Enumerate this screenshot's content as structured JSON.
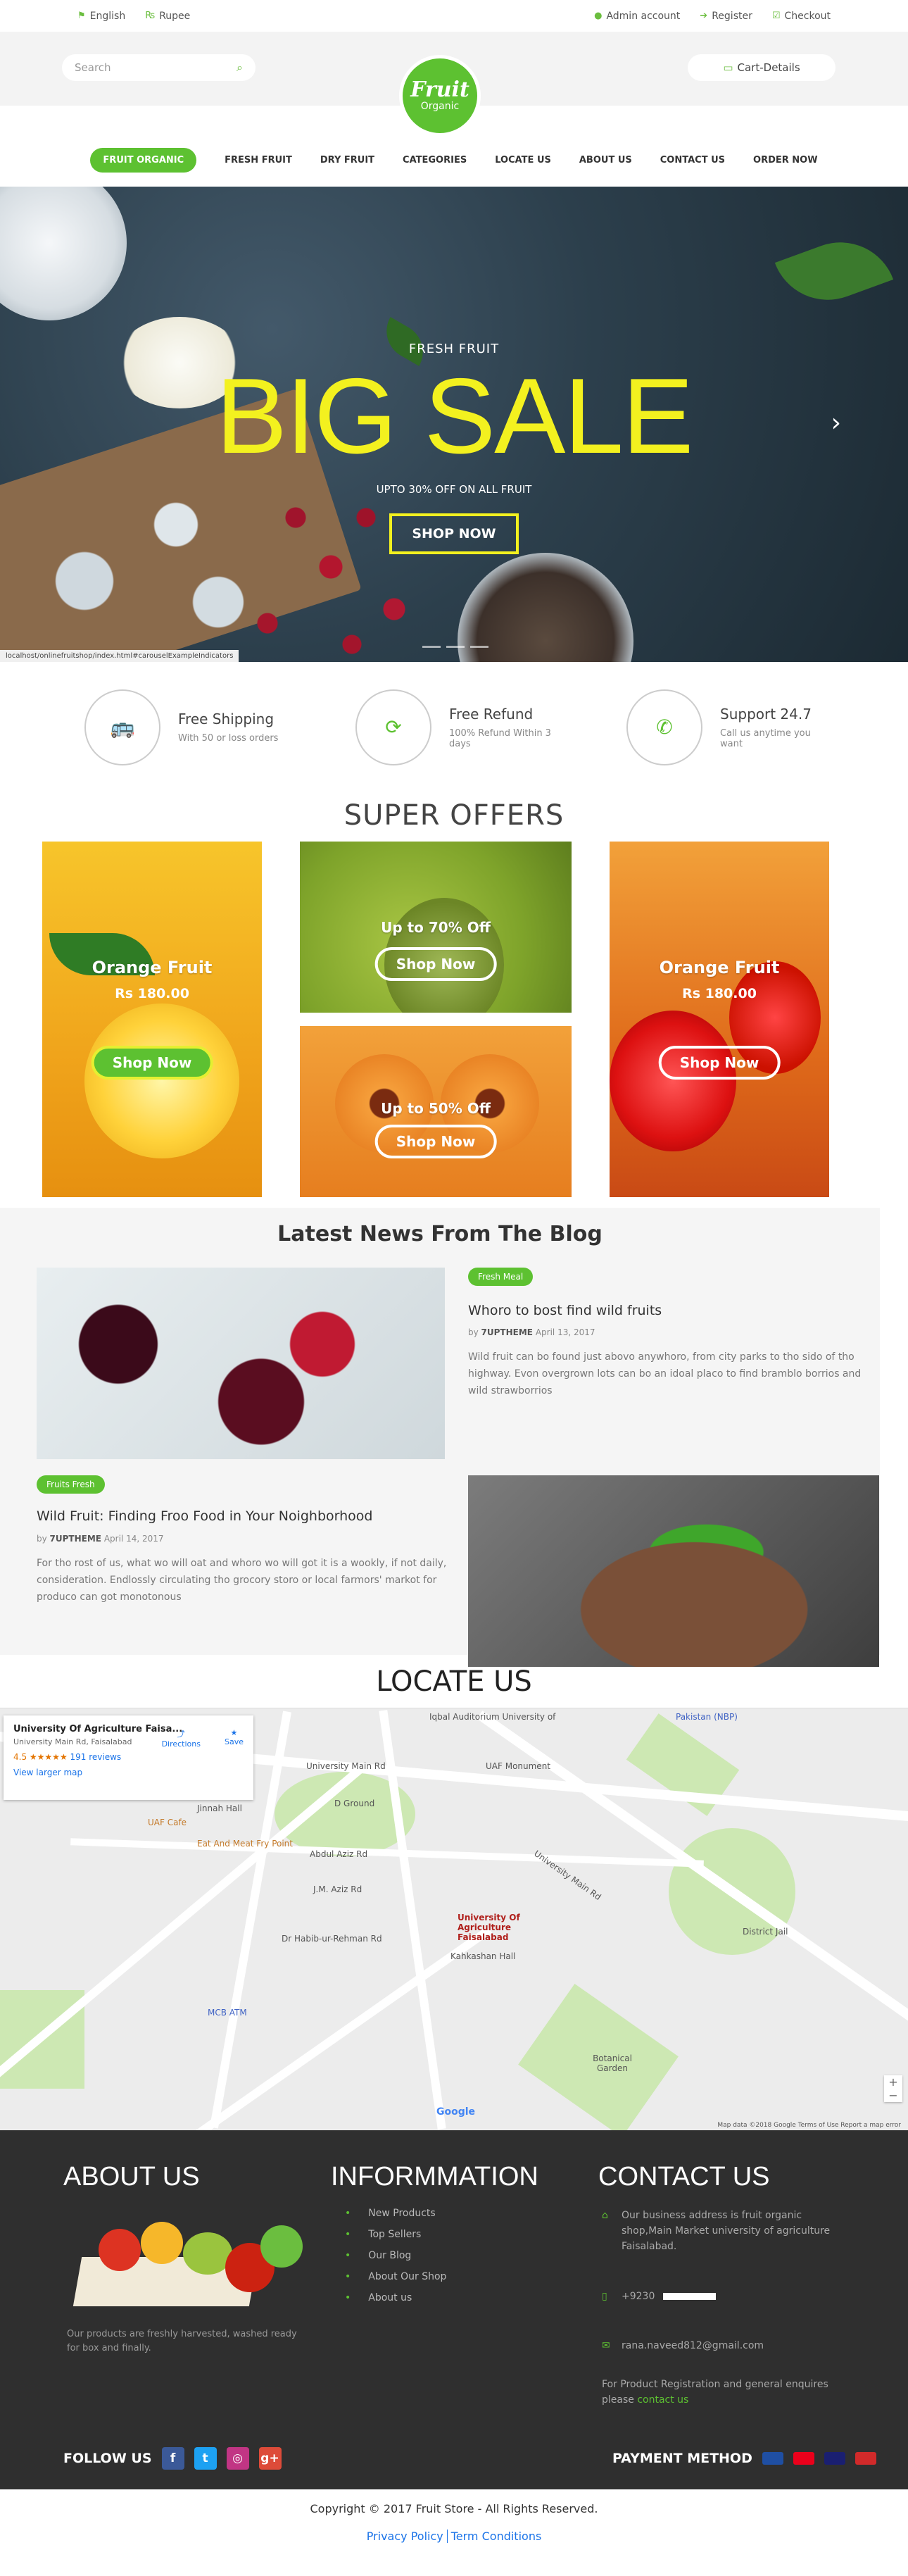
{
  "topbar": {
    "left": [
      {
        "icon": "flag-icon",
        "label": "English"
      },
      {
        "icon": "currency-icon",
        "label": "Rupee"
      }
    ],
    "right": [
      {
        "icon": "user-icon",
        "label": "Admin account"
      },
      {
        "icon": "login-icon",
        "label": "Register"
      },
      {
        "icon": "checkout-icon",
        "label": "Checkout"
      }
    ]
  },
  "header": {
    "search_placeholder": "Search",
    "logo_top": "Fruit",
    "logo_bottom": "Organic",
    "cart_label": "Cart-Details"
  },
  "nav": {
    "active": "FRUIT ORGANIC",
    "items": [
      "FRESH FRUIT",
      "DRY FRUIT",
      "CATEGORIES",
      "LOCATE US",
      "ABOUT US",
      "CONTACT US",
      "ORDER NOW"
    ]
  },
  "hero": {
    "subtitle": "FRESH FRUIT",
    "headline": "BIG SALE",
    "offer": "UPTO 30% OFF ON ALL FRUIT",
    "button": "SHOP NOW",
    "status_url": "localhost/onlinefruitshop/index.html#carouselExampleIndicators"
  },
  "features": [
    {
      "title": "Free Shipping",
      "desc": "With 50 or loss orders"
    },
    {
      "title": "Free Refund",
      "desc": "100% Refund Within 3 days"
    },
    {
      "title": "Support 24.7",
      "desc": "Call us anytime you want"
    }
  ],
  "offers": {
    "title": "SUPER OFFERS",
    "card1": {
      "name": "Orange Fruit",
      "price": "Rs 180.00",
      "button": "Shop Now"
    },
    "card2": {
      "text": "Up to 70% Off",
      "button": "Shop Now"
    },
    "card3": {
      "text": "Up to 50% Off",
      "button": "Shop Now"
    },
    "card4": {
      "name": "Orange Fruit",
      "price": "Rs 180.00",
      "button": "Shop Now"
    }
  },
  "blog": {
    "title": "Latest News From The Blog",
    "post1": {
      "tag": "Fresh Meal",
      "title": "Whoro to bost find wild fruits",
      "author": "7UPTHEME",
      "date": "April 13, 2017",
      "desc": "Wild fruit can bo found just abovo anywhoro, from city parks to tho sido of tho highway. Evon overgrown lots can bo an idoal placo to find bramblo borrios and wild strawborrios"
    },
    "post2": {
      "tag": "Fruits Fresh",
      "title": "Wild Fruit: Finding Froo Food in Your Noighborhood",
      "author": "7UPTHEME",
      "date": "April 14, 2017",
      "desc": "For tho rost of us, what wo will oat and whoro wo will got it is a wookly, if not daily, consideration. Endlossly circulating tho grocory storo or local farmors' markot for produco can got monotonous"
    }
  },
  "locate": {
    "title": "LOCATE US",
    "card_title": "University Of Agriculture Faisa...",
    "card_addr": "University Main Rd, Faisalabad",
    "rating": "4.5",
    "reviews": "191 reviews",
    "larger_map": "View larger map",
    "directions": "Directions",
    "save": "Save",
    "labels": [
      "Iqbal Auditorium University of",
      "Pakistan (NBP)",
      "University Main Rd",
      "UAF Monument",
      "Jinnah Hall",
      "UAF Cafe",
      "Eat And Meat Fry Point",
      "D Ground",
      "Abdul Aziz Rd",
      "J.M. Aziz Rd",
      "Dr Habib-ur-Rehman Rd",
      "University Of Agriculture Faisalabad",
      "Kahkashan Hall",
      "District Jail",
      "MCB ATM",
      "Botanical Garden",
      "University Main Rd"
    ],
    "footer": "Map data ©2018 Google   Terms of Use   Report a map error",
    "google": "Google"
  },
  "footer": {
    "about_title": "ABOUT US",
    "about_text": "Our products are freshly harvested, washed ready for box and finally.",
    "info_title": "INFORMMATION",
    "info_links": [
      "New Products",
      "Top Sellers",
      "Our Blog",
      "About Our Shop",
      "About us"
    ],
    "contact_title": "CONTACT US",
    "address": "Our business address is fruit organic shop,Main Market university of agriculture Faisalabad.",
    "phone": "+9230",
    "email": "rana.naveed812@gmail.com",
    "enquiry": "For Product Registration and general enquires please",
    "contact_link": "contact us",
    "follow": "FOLLOW US",
    "payment": "PAYMENT METHOD"
  },
  "copyright": {
    "text": "Copyright © 2017 Fruit Store - All Rights Reserved.",
    "privacy": "Privacy Policy",
    "terms": "Term Conditions"
  },
  "colors": {
    "accent": "#5dc131",
    "hero_yellow": "#f3f11f",
    "footer_bg": "#2f2f2f"
  }
}
